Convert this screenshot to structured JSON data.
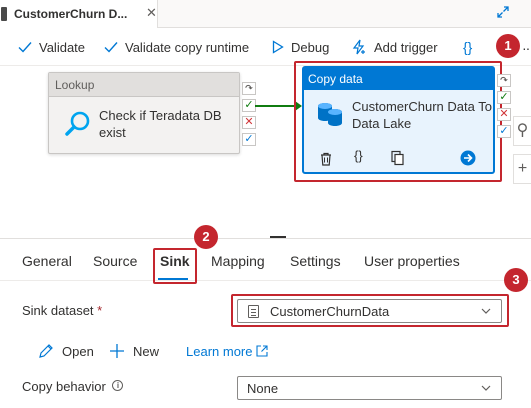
{
  "tab": {
    "title": "CustomerChurn D...",
    "close_glyph": "✕",
    "expand_icon": "expand-icon"
  },
  "toolbar": {
    "validate": "Validate",
    "validate_copy_runtime": "Validate copy runtime",
    "debug": "Debug",
    "add_trigger": "Add trigger",
    "code": "{}",
    "more": "···"
  },
  "canvas": {
    "lookup": {
      "type": "Lookup",
      "name": "Check if Teradata DB exist"
    },
    "copy": {
      "type": "Copy data",
      "name": "CustomerChurn Data To Data Lake"
    },
    "status_glyphs": {
      "skip": "↷",
      "success": "✓",
      "failure": "✕",
      "completion": "✓"
    },
    "tools": {
      "search": "⚲",
      "zoom_in": "+"
    }
  },
  "properties": {
    "tabs": [
      "General",
      "Source",
      "Sink",
      "Mapping",
      "Settings",
      "User properties"
    ],
    "active_tab": "Sink",
    "sink_dataset_label": "Sink dataset",
    "required_marker": "*",
    "sink_dataset_value": "CustomerChurnData",
    "open": "Open",
    "new": "New",
    "learn_more": "Learn more",
    "copy_behavior_label": "Copy behavior",
    "info_glyph": "i",
    "copy_behavior_value": "None"
  },
  "callouts": [
    "1",
    "2",
    "3"
  ],
  "colors": {
    "accent": "#0078d4",
    "callout": "#c4262e",
    "success": "#107c10",
    "failure": "#d13438"
  }
}
